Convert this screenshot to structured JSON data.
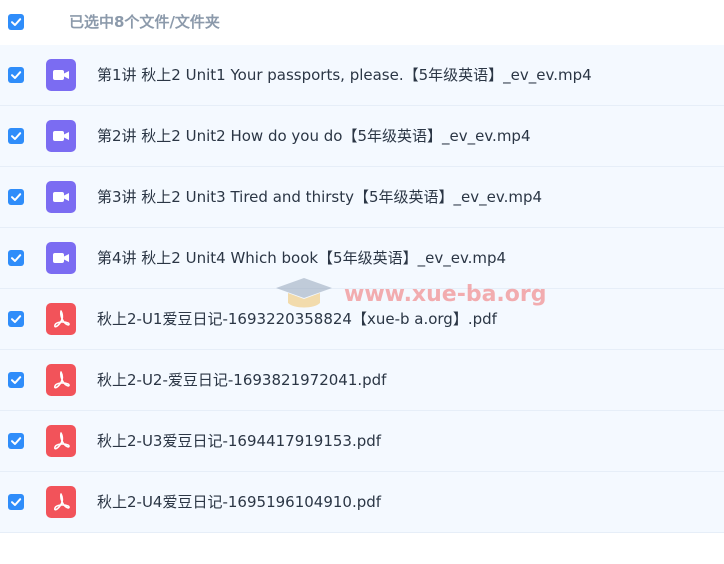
{
  "header": {
    "title": "已选中8个文件/文件夹",
    "checked": true
  },
  "files": [
    {
      "name": "第1讲 秋上2 Unit1 Your passports, please.【5年级英语】_ev_ev.mp4",
      "type": "video",
      "icon": "video-file-icon",
      "checked": true
    },
    {
      "name": "第2讲 秋上2 Unit2 How do you do【5年级英语】_ev_ev.mp4",
      "type": "video",
      "icon": "video-file-icon",
      "checked": true
    },
    {
      "name": "第3讲 秋上2 Unit3 Tired and thirsty【5年级英语】_ev_ev.mp4",
      "type": "video",
      "icon": "video-file-icon",
      "checked": true
    },
    {
      "name": "第4讲 秋上2 Unit4 Which book【5年级英语】_ev_ev.mp4",
      "type": "video",
      "icon": "video-file-icon",
      "checked": true
    },
    {
      "name": "秋上2-U1爱豆日记-1693220358824【xue-b a.org】.pdf",
      "type": "pdf",
      "icon": "pdf-file-icon",
      "checked": true
    },
    {
      "name": "秋上2-U2-爱豆日记-1693821972041.pdf",
      "type": "pdf",
      "icon": "pdf-file-icon",
      "checked": true
    },
    {
      "name": "秋上2-U3爱豆日记-1694417919153.pdf",
      "type": "pdf",
      "icon": "pdf-file-icon",
      "checked": true
    },
    {
      "name": "秋上2-U4爱豆日记-1695196104910.pdf",
      "type": "pdf",
      "icon": "pdf-file-icon",
      "checked": true
    }
  ],
  "watermark": {
    "text": "www.xue-ba.org"
  },
  "colors": {
    "checkbox": "#2f8dfa",
    "row_bg": "#f4f9ff",
    "video_icon": "#7b6cf2",
    "pdf_icon": "#f2535a",
    "header_text": "#8c9aab"
  }
}
